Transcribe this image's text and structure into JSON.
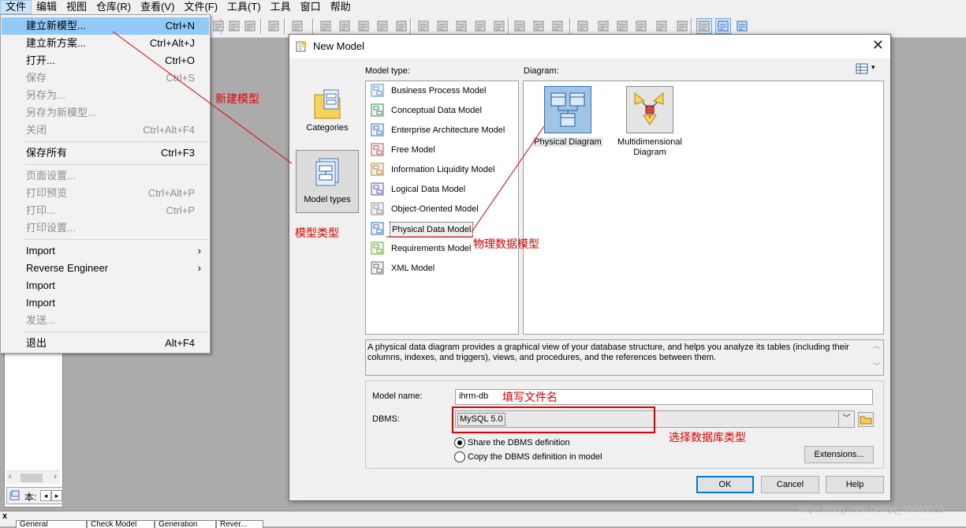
{
  "menubar": {
    "items": [
      "文件",
      "编辑",
      "视图",
      "仓库(R)",
      "查看(V)",
      "文件(F)",
      "工具(T)",
      "工具",
      "窗口",
      "帮助"
    ]
  },
  "file_menu": {
    "items": [
      {
        "label": "建立新模型...",
        "shortcut": "Ctrl+N",
        "state": "highlighted"
      },
      {
        "label": "建立新方案...",
        "shortcut": "Ctrl+Alt+J",
        "state": "enabled"
      },
      {
        "label": "打开...",
        "shortcut": "Ctrl+O",
        "state": "enabled"
      },
      {
        "label": "保存",
        "shortcut": "Ctrl+S",
        "state": "disabled"
      },
      {
        "label": "另存为...",
        "shortcut": "",
        "state": "disabled"
      },
      {
        "label": "另存为新模型...",
        "shortcut": "",
        "state": "disabled"
      },
      {
        "label": "关闭",
        "shortcut": "Ctrl+Alt+F4",
        "state": "disabled"
      },
      {
        "label": "保存所有",
        "shortcut": "Ctrl+F3",
        "state": "enabled"
      },
      {
        "label": "页面设置...",
        "shortcut": "",
        "state": "disabled"
      },
      {
        "label": "打印预览",
        "shortcut": "Ctrl+Alt+P",
        "state": "disabled"
      },
      {
        "label": "打印...",
        "shortcut": "Ctrl+P",
        "state": "disabled"
      },
      {
        "label": "打印设置...",
        "shortcut": "",
        "state": "disabled"
      },
      {
        "label": "Import",
        "shortcut": "",
        "state": "submenu"
      },
      {
        "label": "Reverse Engineer",
        "shortcut": "",
        "state": "submenu"
      },
      {
        "label": "Import",
        "shortcut": "",
        "state": "enabled"
      },
      {
        "label": "Import",
        "shortcut": "",
        "state": "enabled"
      },
      {
        "label": "发送...",
        "shortcut": "",
        "state": "disabled"
      },
      {
        "label": "退出",
        "shortcut": "Alt+F4",
        "state": "enabled"
      }
    ]
  },
  "browser": {
    "tab_label": "本:"
  },
  "output": {
    "tabs": [
      "General",
      "Check Model",
      "Generation",
      "Rever..."
    ]
  },
  "dialog": {
    "title": "New Model",
    "close": "✕",
    "categories": [
      {
        "label": "Categories",
        "selected": false
      },
      {
        "label": "Model types",
        "selected": true
      }
    ],
    "model_type_label": "Model type:",
    "diagram_label": "Diagram:",
    "model_types": [
      {
        "label": "Business Process Model",
        "icon": "bpm-icon"
      },
      {
        "label": "Conceptual Data Model",
        "icon": "cdm-icon"
      },
      {
        "label": "Enterprise Architecture Model",
        "icon": "eam-icon"
      },
      {
        "label": "Free Model",
        "icon": "free-model-icon"
      },
      {
        "label": "Information Liquidity Model",
        "icon": "ilm-icon"
      },
      {
        "label": "Logical Data Model",
        "icon": "ldm-icon"
      },
      {
        "label": "Object-Oriented Model",
        "icon": "oom-icon"
      },
      {
        "label": "Physical Data Model",
        "icon": "pdm-icon",
        "selected": true
      },
      {
        "label": "Requirements Model",
        "icon": "rq-icon"
      },
      {
        "label": "XML Model",
        "icon": "xml-icon"
      }
    ],
    "diagrams": [
      {
        "label": "Physical Diagram",
        "selected": true
      },
      {
        "label": "Multidimensional Diagram",
        "selected": false
      }
    ],
    "description": "A physical data diagram provides a graphical view of your database structure, and helps you analyze its tables (including their columns, indexes, and triggers), views, and procedures, and the references between them.",
    "model_name_label": "Model name:",
    "model_name_value": "ihrm-db",
    "dbms_label": "DBMS:",
    "dbms_value": "MySQL 5.0",
    "radio_share": "Share the DBMS definition",
    "radio_copy": "Copy the DBMS definition in model",
    "radio_selected": "share",
    "extensions_button": "Extensions...",
    "ok_button": "OK",
    "cancel_button": "Cancel",
    "help_button": "Help"
  },
  "annotations": {
    "new_model": "新建模型",
    "model_types": "模型类型",
    "physical_model": "物理数据模型",
    "fill_filename": "填写文件名",
    "select_db_type": "选择数据库类型",
    "color": "#e00000"
  },
  "watermark": "https://blog.csdn.net/qq_40640628"
}
